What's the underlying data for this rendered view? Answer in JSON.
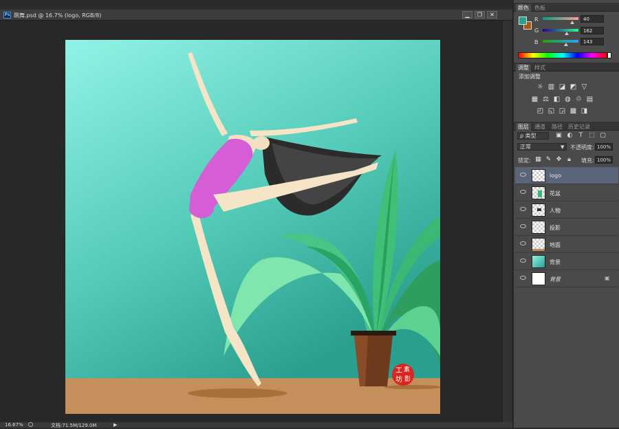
{
  "document": {
    "ps_badge": "Ps",
    "title": "跳舞.psd @ 16.7% (logo, RGB/8)",
    "window_buttons": [
      "▁",
      "❐",
      "✕"
    ]
  },
  "status": {
    "zoom": "16.67%",
    "doc_size": "文档:71.5M/129.0M"
  },
  "color_panel": {
    "tabs": [
      "颜色",
      "色板"
    ],
    "channels": [
      {
        "label": "R",
        "value": "40"
      },
      {
        "label": "G",
        "value": "162"
      },
      {
        "label": "B",
        "value": "143"
      }
    ],
    "foreground": "#28a28f",
    "background": "#a35a12"
  },
  "adjust_panel": {
    "tabs": [
      "调整",
      "样式"
    ],
    "heading": "添加调整",
    "icons": [
      "brightness-icon",
      "levels-icon",
      "curves-icon",
      "exposure-icon",
      "vibrance-icon",
      "hue-saturation-icon",
      "color-balance-icon",
      "black-white-icon",
      "photo-filter-icon",
      "channel-mixer-icon",
      "color-lookup-icon",
      "invert-icon",
      "posterize-icon",
      "threshold-icon",
      "gradient-map-icon",
      "selective-color-icon"
    ]
  },
  "layers_panel": {
    "tabs": [
      "图层",
      "通道",
      "路径",
      "历史记录"
    ],
    "filter_label": "ρ 类型",
    "blend_mode": "正常",
    "opacity_label": "不透明度:",
    "opacity_value": "100%",
    "lock_label": "锁定:",
    "fill_label": "填充:",
    "fill_value": "100%",
    "layers": [
      {
        "name": "logo",
        "selected": true
      },
      {
        "name": "花盆",
        "selected": false
      },
      {
        "name": "人物",
        "selected": false
      },
      {
        "name": "投影",
        "selected": false
      },
      {
        "name": "地面",
        "selected": false
      },
      {
        "name": "背景",
        "selected": false
      },
      {
        "name": "背景",
        "selected": false
      }
    ]
  },
  "artwork": {
    "seal_chars": [
      "工",
      "素",
      "坊",
      "影"
    ],
    "colors": {
      "sky_top": "#8ef2e4",
      "sky_bottom": "#2ea593",
      "ground": "#c38f5a",
      "leotard": "#d45ad8",
      "pot": "#6b3a1e"
    }
  }
}
